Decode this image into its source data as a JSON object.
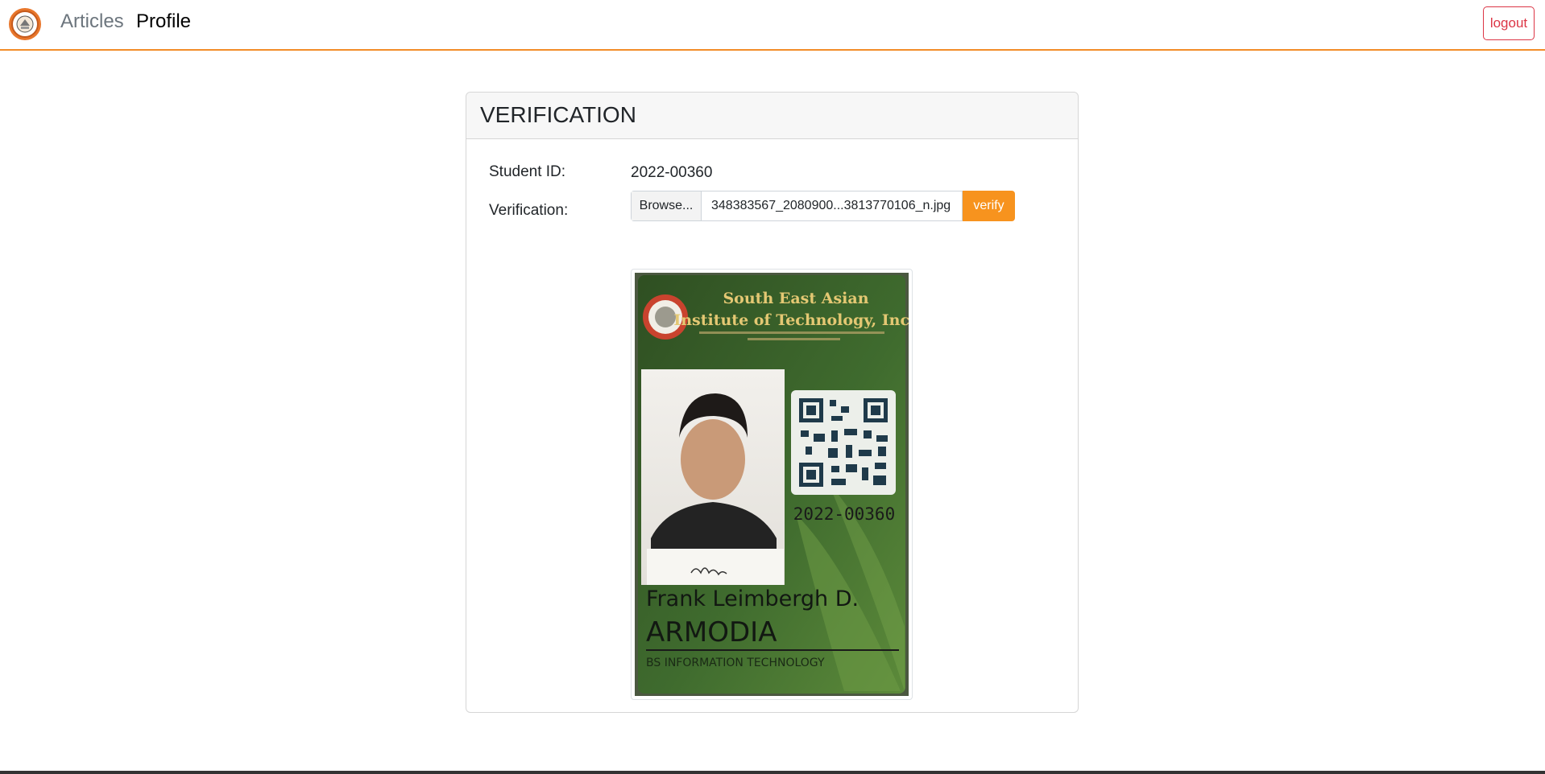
{
  "nav": {
    "links": [
      {
        "label": "Articles"
      },
      {
        "label": "Profile"
      }
    ],
    "logout_label": "logout"
  },
  "card": {
    "title": "VERIFICATION",
    "student_id_label": "Student ID:",
    "student_id_value": "2022-00360",
    "verification_label": "Verification:",
    "browse_label": "Browse...",
    "file_name": "348383567_2080900...3813770106_n.jpg",
    "verify_label": "verify"
  },
  "id_card": {
    "school_line1": "South East Asian",
    "school_line2": "Institute of Technology, Inc.",
    "student_number": "2022-00360",
    "first_name": "Frank Leimbergh D.",
    "last_name": "ARMODIA",
    "course": "BS INFORMATION TECHNOLOGY"
  },
  "colors": {
    "accent": "#f28c28",
    "verify_button": "#f7931e",
    "logout": "#dc3545",
    "card_green": "#3f6b2e"
  }
}
